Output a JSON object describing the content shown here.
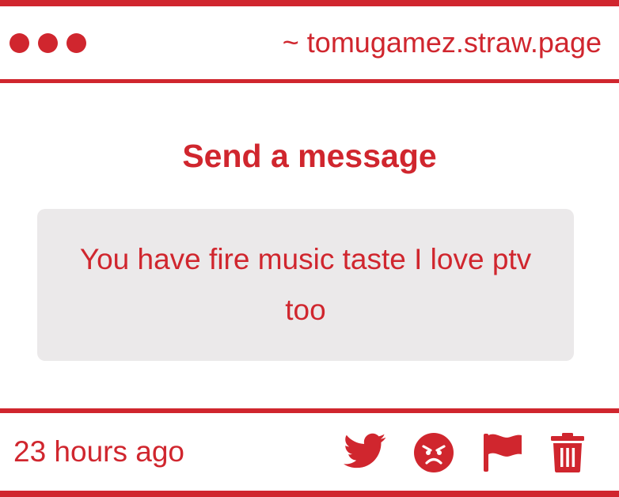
{
  "window": {
    "url": "~ tomugamez.straw.page"
  },
  "main": {
    "heading": "Send a message",
    "message": "You have fire music taste I love ptv too"
  },
  "footer": {
    "timestamp": "23 hours ago",
    "actions": [
      {
        "icon": "twitter-bird-icon"
      },
      {
        "icon": "angry-face-icon"
      },
      {
        "icon": "flag-icon"
      },
      {
        "icon": "trash-icon"
      }
    ]
  },
  "colors": {
    "accent": "#d0262e",
    "card_background": "#ebe9ea",
    "background": "#ffffff"
  }
}
